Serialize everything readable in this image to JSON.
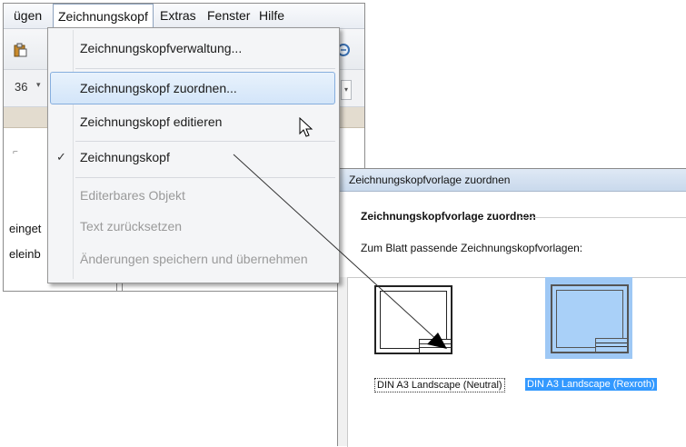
{
  "menubar": {
    "items": [
      "ügen",
      "Zeichnungskopf",
      "Extras",
      "Fenster",
      "Hilfe"
    ],
    "active_index": 1
  },
  "toolbar": {
    "combo_value": "36",
    "combo_arrow_icon": "chevron-down-icon"
  },
  "app_content": {
    "text_line1": "einget",
    "text_line2": "eleinb"
  },
  "dropdown": {
    "items": [
      {
        "label": "Zeichnungskopfverwaltung...",
        "enabled": true,
        "checked": false
      },
      {
        "label": "Zeichnungskopf zuordnen...",
        "enabled": true,
        "checked": false,
        "highlighted": true
      },
      {
        "label": "Zeichnungskopf editieren",
        "enabled": true,
        "checked": false
      },
      {
        "label": "Zeichnungskopf",
        "enabled": true,
        "checked": true
      },
      {
        "label": "Editerbares Objekt",
        "enabled": false,
        "checked": false
      },
      {
        "label": "Text zurücksetzen",
        "enabled": false,
        "checked": false
      },
      {
        "label": "Änderungen speichern und übernehmen",
        "enabled": false,
        "checked": false
      }
    ],
    "check_glyph": "✓"
  },
  "dialog": {
    "title": "Zeichnungskopfvorlage zuordnen",
    "heading": "Zeichnungskopfvorlage zuordnen",
    "subtitle": "Zum Blatt passende Zeichnungskopfvorlagen:",
    "templates": [
      {
        "label": "DIN A3 Landscape (Neutral)",
        "selected": false
      },
      {
        "label": "DIN A3 Landscape (Rexroth)",
        "selected": true
      }
    ]
  },
  "colors": {
    "selection": "#3399ff",
    "menu_highlight": "#d3e5f9",
    "disabled_text": "#9a9a9a"
  }
}
